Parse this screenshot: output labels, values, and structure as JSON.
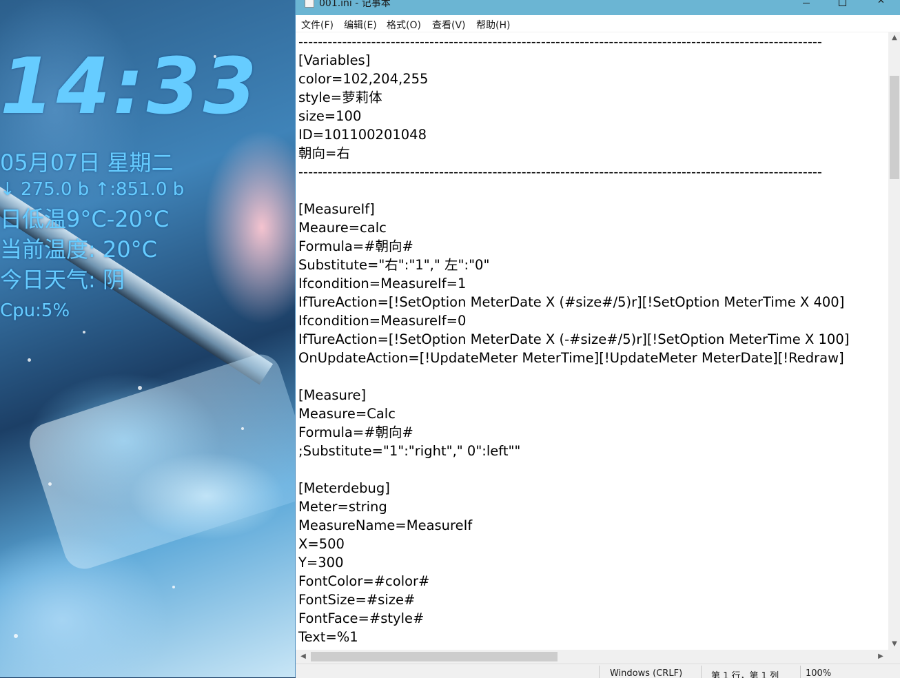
{
  "desktop": {
    "widget": {
      "time": "14:33",
      "date": "05月07日 星期二",
      "network": "↓ 275.0 b ↑:851.0 b",
      "temp_range": "日低温9°C-20°C",
      "current_temp": "当前温度: 20°C",
      "weather": "今日天气: 阴",
      "cpu": "Cpu:5%",
      "color": "#66ccff"
    }
  },
  "window": {
    "title": "001.ini - 记事本",
    "controls": {
      "minimize": "minimize-icon",
      "maximize": "maximize-icon",
      "close": "close-icon"
    },
    "titlebar_color": "#6bb5d3"
  },
  "menubar": {
    "items": [
      {
        "label": "文件(F)"
      },
      {
        "label": "编辑(E)"
      },
      {
        "label": "格式(O)"
      },
      {
        "label": "查看(V)"
      },
      {
        "label": "帮助(H)"
      }
    ]
  },
  "editor": {
    "lines": [
      "------------------------------------------------------------------------------------------------------------",
      "[Variables]",
      "color=102,204,255",
      "style=萝莉体",
      "size=100",
      "ID=101100201048",
      "朝向=右",
      "------------------------------------------------------------------------------------------------------------",
      "",
      "[MeasureIf]",
      "Meaure=calc",
      "Formula=#朝向#",
      "Substitute=\"右\":\"1\",\" 左\":\"0\"",
      "Ifcondition=MeasureIf=1",
      "IfTureAction=[!SetOption MeterDate X (#size#/5)r][!SetOption MeterTime X 400]",
      "Ifcondition=MeasureIf=0",
      "IfTureAction=[!SetOption MeterDate X (-#size#/5)r][!SetOption MeterTime X 100]",
      "OnUpdateAction=[!UpdateMeter MeterTime][!UpdateMeter MeterDate][!Redraw]",
      "",
      "[Measure]",
      "Measure=Calc",
      "Formula=#朝向#",
      ";Substitute=\"1\":\"right\",\" 0\":left\"\"",
      "",
      "[Meterdebug]",
      "Meter=string",
      "MeasureName=MeasureIf",
      "X=500",
      "Y=300",
      "FontColor=#color#",
      "FontSize=#size#",
      "FontFace=#style#",
      "Text=%1"
    ]
  },
  "scrollbars": {
    "vertical": {
      "up_icon": "chevron-up-icon",
      "down_icon": "chevron-down-icon"
    },
    "horizontal": {
      "left_icon": "chevron-left-icon",
      "right_icon": "chevron-right-icon"
    }
  },
  "statusbar": {
    "encoding": "Windows (CRLF)",
    "position": "第 1 行，第 1 列",
    "zoom": "100%"
  }
}
